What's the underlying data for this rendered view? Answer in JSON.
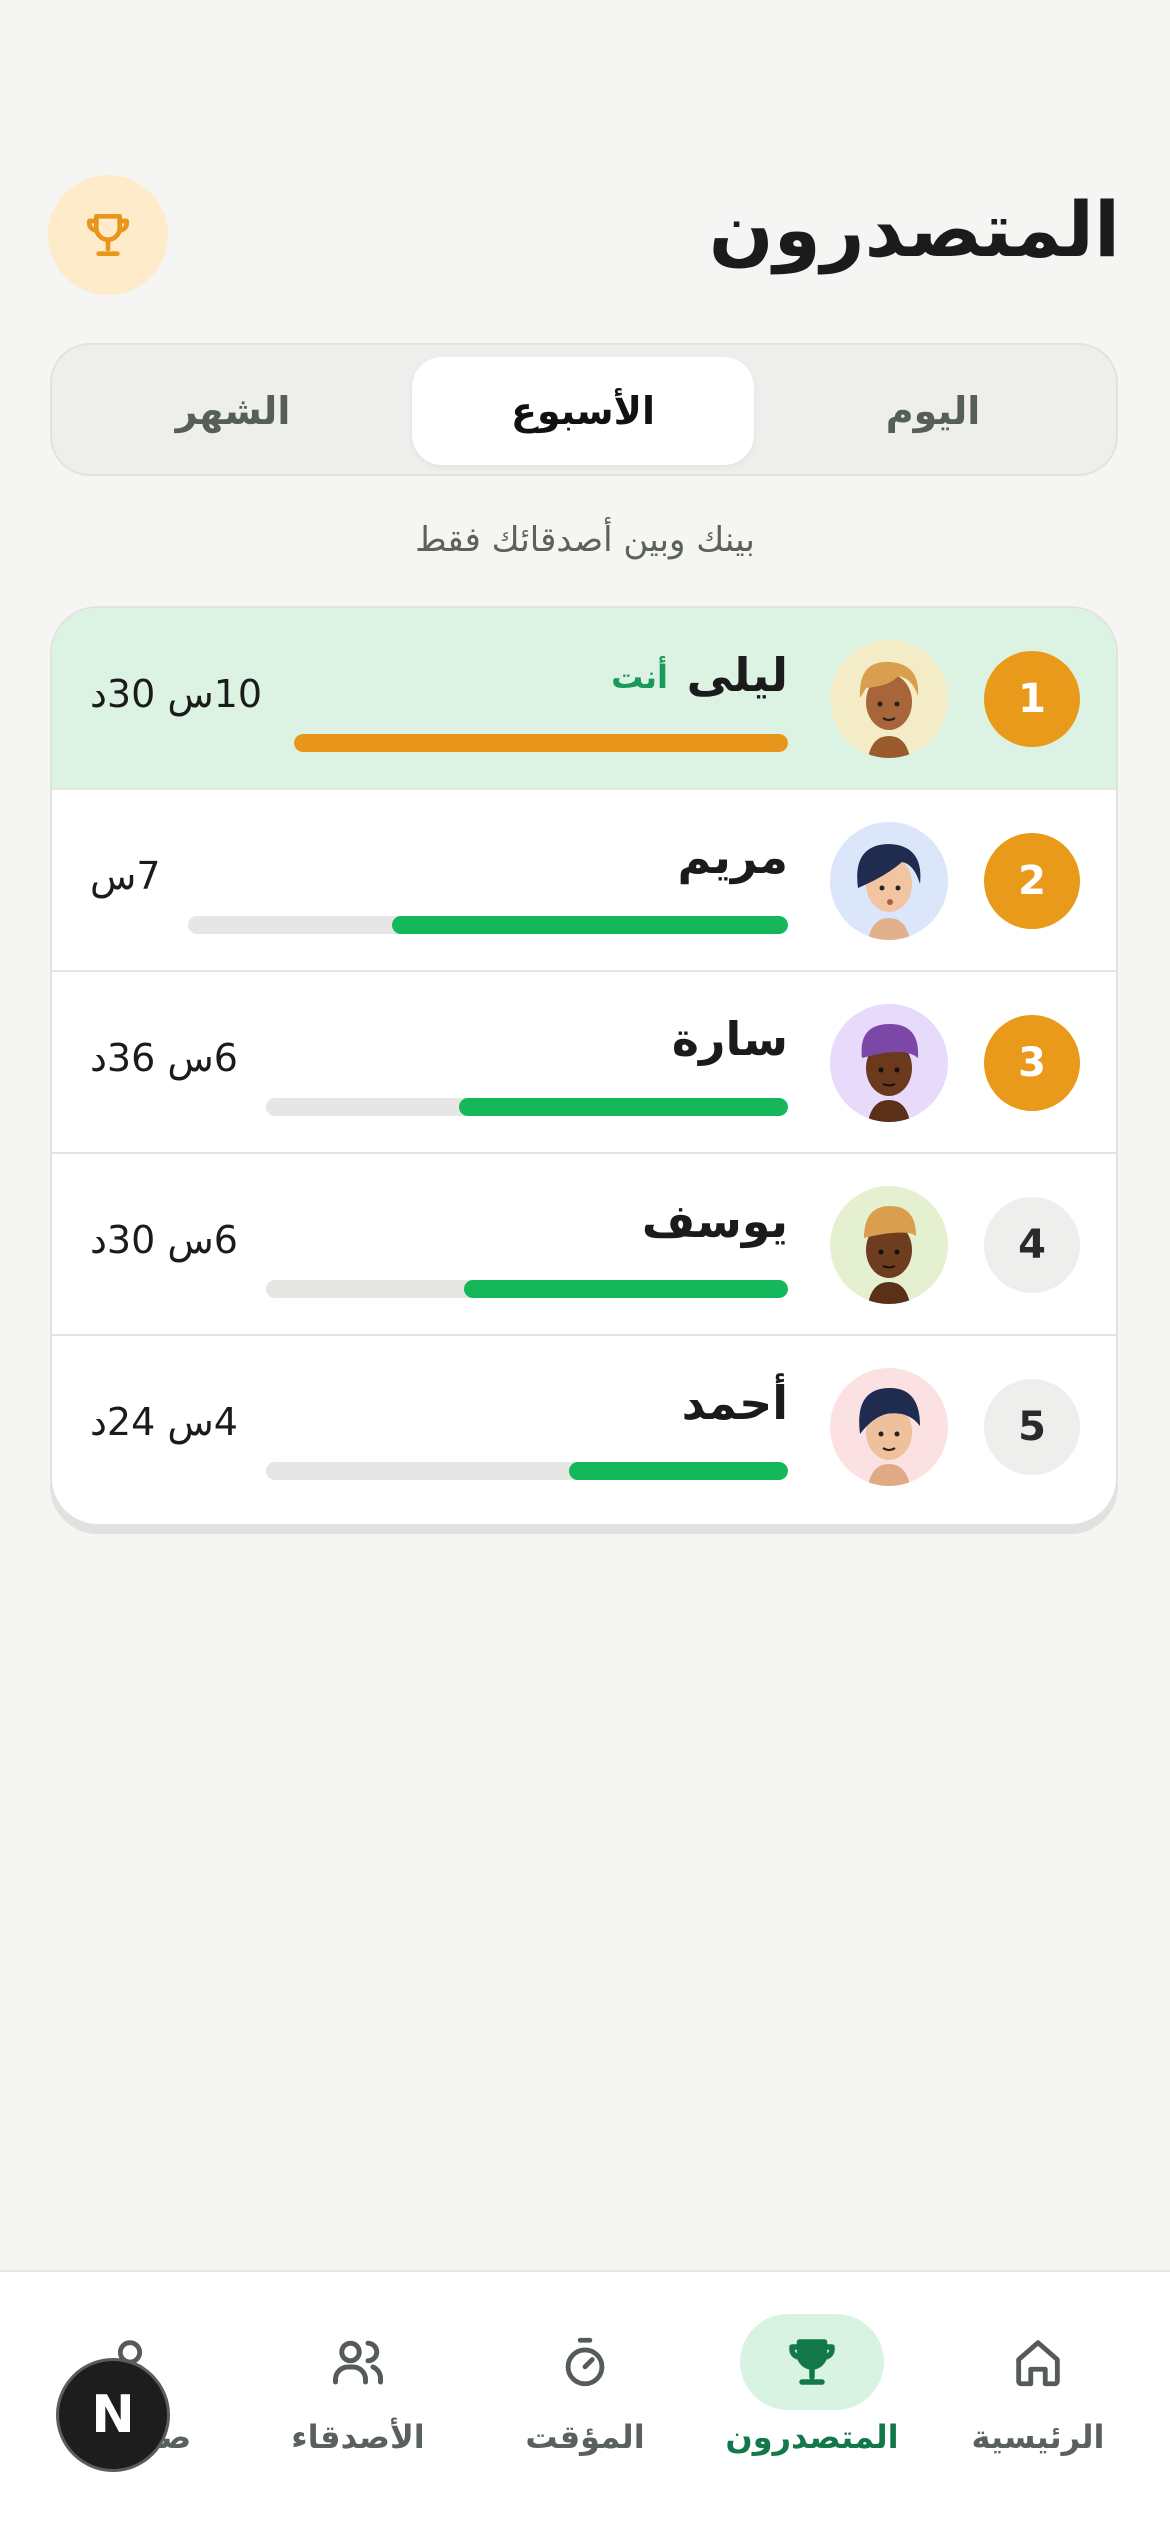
{
  "header": {
    "title": "المتصدرون"
  },
  "tabs": [
    {
      "label": "اليوم",
      "active": false
    },
    {
      "label": "الأسبوع",
      "active": true
    },
    {
      "label": "الشهر",
      "active": false
    }
  ],
  "subtitle": "بينك وبين أصدقائك فقط",
  "leaderboard": [
    {
      "rank": "1",
      "name": "ليلى",
      "you_label": "أنت",
      "time": "10س 30د",
      "progress": 1.0,
      "bar_color": "#e8951c",
      "avatar_bg": "#f3ecc6",
      "medal": true
    },
    {
      "rank": "2",
      "name": "مريم",
      "time": "7س",
      "progress": 0.66,
      "bar_color": "#14b85a",
      "avatar_bg": "#dbe6fb",
      "medal": true
    },
    {
      "rank": "3",
      "name": "سارة",
      "time": "6س 36د",
      "progress": 0.63,
      "bar_color": "#14b85a",
      "avatar_bg": "#e7dafa",
      "medal": true
    },
    {
      "rank": "4",
      "name": "يوسف",
      "time": "6س 30د",
      "progress": 0.62,
      "bar_color": "#14b85a",
      "avatar_bg": "#e5f0d1",
      "medal": false
    },
    {
      "rank": "5",
      "name": "أحمد",
      "time": "4س 24د",
      "progress": 0.42,
      "bar_color": "#14b85a",
      "avatar_bg": "#fbe1e2",
      "medal": false
    }
  ],
  "nav": [
    {
      "label": "الرئيسية",
      "icon": "home-icon",
      "active": false
    },
    {
      "label": "المتصدرون",
      "icon": "trophy-icon",
      "active": true
    },
    {
      "label": "المؤقت",
      "icon": "timer-icon",
      "active": false
    },
    {
      "label": "الأصدقاء",
      "icon": "friends-icon",
      "active": false
    },
    {
      "label": "صفحتي",
      "icon": "profile-icon",
      "active": false
    }
  ],
  "overlay": {
    "badge_letter": "N"
  },
  "colors": {
    "accent_green": "#14b85a",
    "accent_orange": "#e8951c",
    "me_row_bg": "#dcf3e4"
  }
}
